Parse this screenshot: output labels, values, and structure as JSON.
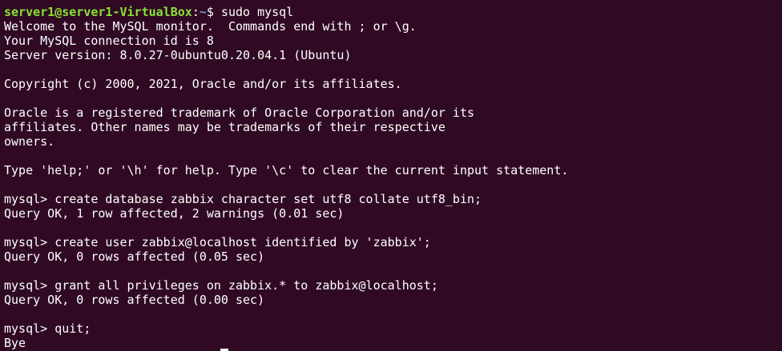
{
  "prompt": {
    "user_host": "server1@server1-VirtualBox",
    "colon": ":",
    "path": "~",
    "symbol": "$ ",
    "command": "sudo mysql"
  },
  "lines": [
    "Welcome to the MySQL monitor.  Commands end with ; or \\g.",
    "Your MySQL connection id is 8",
    "Server version: 8.0.27-0ubuntu0.20.04.1 (Ubuntu)",
    "",
    "Copyright (c) 2000, 2021, Oracle and/or its affiliates.",
    "",
    "Oracle is a registered trademark of Oracle Corporation and/or its",
    "affiliates. Other names may be trademarks of their respective",
    "owners.",
    "",
    "Type 'help;' or '\\h' for help. Type '\\c' to clear the current input statement.",
    "",
    "mysql> create database zabbix character set utf8 collate utf8_bin;",
    "Query OK, 1 row affected, 2 warnings (0.01 sec)",
    "",
    "mysql> create user zabbix@localhost identified by 'zabbix';",
    "Query OK, 0 rows affected (0.05 sec)",
    "",
    "mysql> grant all privileges on zabbix.* to zabbix@localhost;",
    "Query OK, 0 rows affected (0.00 sec)",
    "",
    "mysql> quit;",
    "Bye"
  ]
}
